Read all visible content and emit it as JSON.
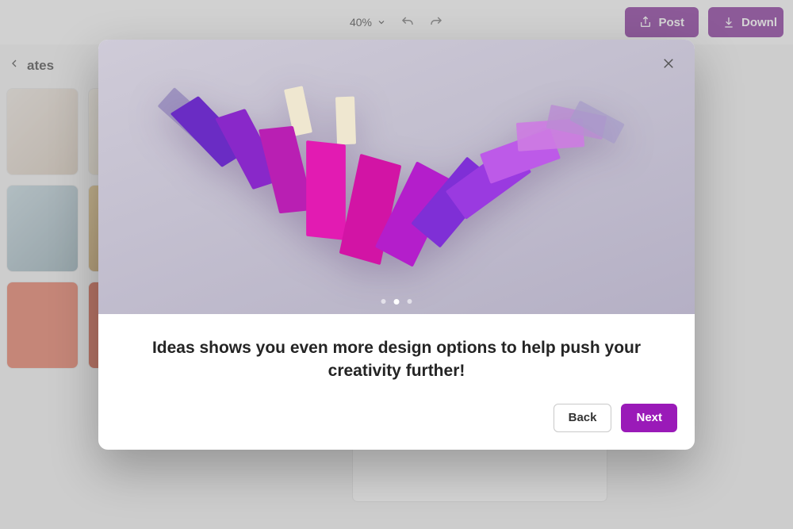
{
  "toolbar": {
    "zoom_level": "40%",
    "post_label": "Post",
    "download_label": "Downl"
  },
  "sidebar": {
    "heading": "ates"
  },
  "dialog": {
    "headline": "Ideas shows you even more design options to help push your creativity further!",
    "back_label": "Back",
    "next_label": "Next",
    "pagination": {
      "count": 3,
      "active_index": 1
    }
  },
  "colors": {
    "accent": "#9a1ab8"
  }
}
